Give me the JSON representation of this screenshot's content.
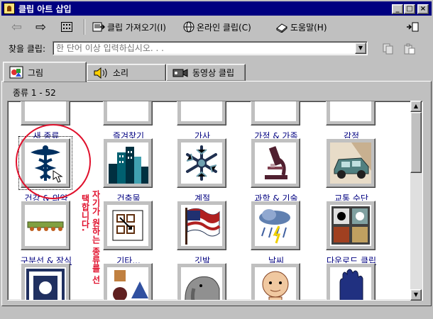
{
  "window": {
    "title": "클립 아트 삽입"
  },
  "titlebar_buttons": {
    "minimize": "_",
    "maximize": "□",
    "close": "×"
  },
  "toolbar": {
    "import_label": "클립 가져오기(I)",
    "online_label": "온라인 클립(C)",
    "help_label": "도움말(H)"
  },
  "search": {
    "label": "찾을 클립:",
    "placeholder": "한 단어 이상 입력하십시오. . ."
  },
  "tabs": [
    {
      "label": "그림",
      "icon": "picture-icon"
    },
    {
      "label": "소리",
      "icon": "speaker-icon"
    },
    {
      "label": "동영상 클립",
      "icon": "film-icon"
    }
  ],
  "count_text": "종류 1 - 52",
  "categories": [
    {
      "label": "새 종류",
      "icon": "new-category-icon"
    },
    {
      "label": "즐겨찾기",
      "icon": "favorites-icon"
    },
    {
      "label": "가사",
      "icon": "desk-icon"
    },
    {
      "label": "가정 & 가족",
      "icon": "family-icon"
    },
    {
      "label": "감정",
      "icon": "emotion-icon"
    },
    {
      "label": "건강 & 의약",
      "icon": "caduceus-icon"
    },
    {
      "label": "건축물",
      "icon": "buildings-icon"
    },
    {
      "label": "계절",
      "icon": "snowflake-icon"
    },
    {
      "label": "과학 & 기술",
      "icon": "microscope-icon"
    },
    {
      "label": "교통 수단",
      "icon": "car-icon"
    },
    {
      "label": "구분선 & 장식",
      "icon": "divider-icon"
    },
    {
      "label": "기타...",
      "icon": "other-icon"
    },
    {
      "label": "깃발",
      "icon": "flag-icon"
    },
    {
      "label": "날씨",
      "icon": "weather-icon"
    },
    {
      "label": "다운로드 클립",
      "icon": "download-icon"
    },
    {
      "label": "",
      "icon": "frame-icon"
    },
    {
      "label": "",
      "icon": "shapes-icon"
    },
    {
      "label": "",
      "icon": "elephant-icon"
    },
    {
      "label": "",
      "icon": "baby-icon"
    },
    {
      "label": "",
      "icon": "glove-icon"
    }
  ],
  "annotation": {
    "col1": "택합니다.",
    "col2": "자기가 원하는 종류를 선"
  },
  "colors": {
    "title_bar": "#000080",
    "link": "#000080",
    "annotation": "#e0102c"
  }
}
